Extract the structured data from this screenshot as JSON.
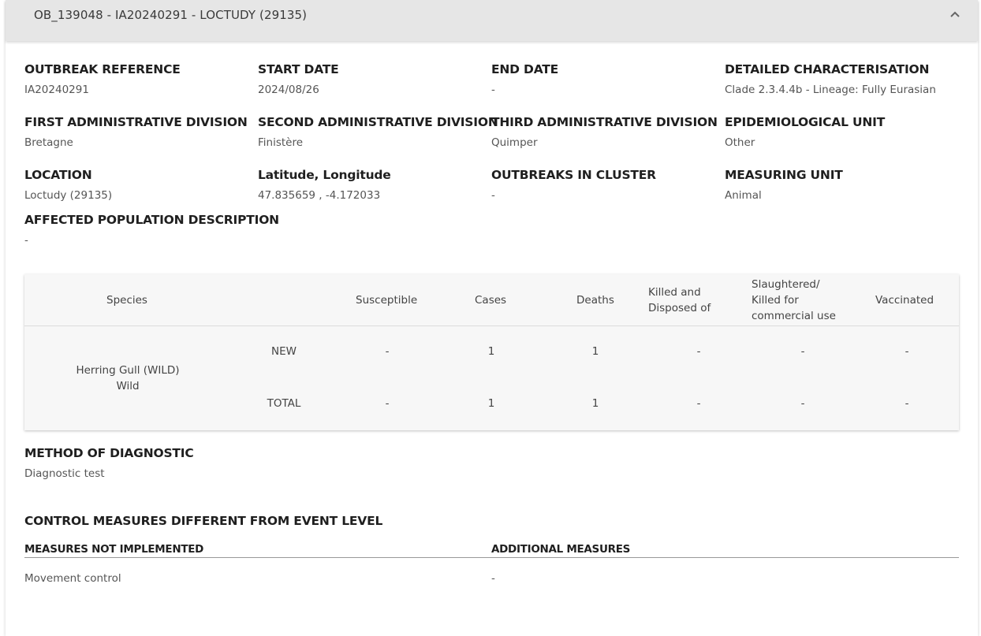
{
  "header": {
    "title": "OB_139048 - IA20240291 - LOCTUDY (29135)",
    "collapse_icon": "chevron-up-icon"
  },
  "details": {
    "outbreak_reference": {
      "label": "OUTBREAK REFERENCE",
      "value": "IA20240291"
    },
    "start_date": {
      "label": "START DATE",
      "value": "2024/08/26"
    },
    "end_date": {
      "label": "END DATE",
      "value": "-"
    },
    "detailed_characterisation": {
      "label": "DETAILED CHARACTERISATION",
      "value": "Clade 2.3.4.4b - Lineage: Fully Eurasian"
    },
    "first_admin_division": {
      "label": "FIRST ADMINISTRATIVE DIVISION",
      "value": "Bretagne"
    },
    "second_admin_division": {
      "label": "SECOND ADMINISTRATIVE DIVISION",
      "value": "Finistère"
    },
    "third_admin_division": {
      "label": "THIRD ADMINISTRATIVE DIVISION",
      "value": "Quimper"
    },
    "epidemiological_unit": {
      "label": "EPIDEMIOLOGICAL UNIT",
      "value": "Other"
    },
    "location": {
      "label": "LOCATION",
      "value": "Loctudy (29135)"
    },
    "lat_long": {
      "label": "Latitude, Longitude",
      "value": "47.835659 , -4.172033"
    },
    "outbreaks_in_cluster": {
      "label": "OUTBREAKS IN CLUSTER",
      "value": "-"
    },
    "measuring_unit": {
      "label": "MEASURING UNIT",
      "value": "Animal"
    },
    "affected_population": {
      "label": "AFFECTED POPULATION DESCRIPTION",
      "value": "-"
    }
  },
  "table": {
    "headers": {
      "species": "Species",
      "susceptible": "Susceptible",
      "cases": "Cases",
      "deaths": "Deaths",
      "killed_line1": "Killed and",
      "killed_line2": "Disposed of",
      "slaughtered_line1": "Slaughtered/",
      "slaughtered_line2": "Killed for",
      "slaughtered_line3": "commercial use",
      "vaccinated": "Vaccinated"
    },
    "species_name": "Herring Gull (WILD)",
    "species_type": "Wild",
    "rows": [
      {
        "label": "NEW",
        "susceptible": "-",
        "cases": "1",
        "deaths": "1",
        "killed": "-",
        "slaughtered": "-",
        "vaccinated": "-"
      },
      {
        "label": "TOTAL",
        "susceptible": "-",
        "cases": "1",
        "deaths": "1",
        "killed": "-",
        "slaughtered": "-",
        "vaccinated": "-"
      }
    ]
  },
  "diagnostic": {
    "label": "METHOD OF DIAGNOSTIC",
    "value": "Diagnostic test"
  },
  "control_measures": {
    "title": "CONTROL MEASURES DIFFERENT FROM EVENT LEVEL",
    "not_implemented_label": "MEASURES NOT IMPLEMENTED",
    "not_implemented_value": "Movement control",
    "additional_label": "ADDITIONAL MEASURES",
    "additional_value": "-"
  }
}
